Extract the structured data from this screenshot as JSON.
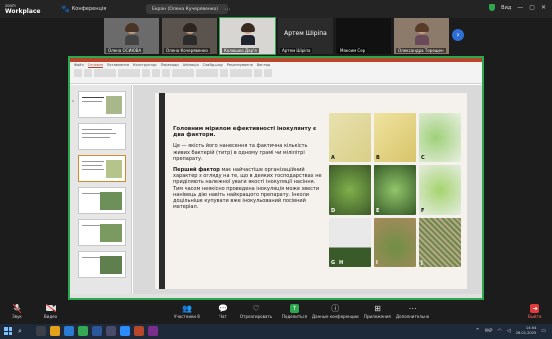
{
  "zoom": {
    "brand_small": "zoom",
    "brand_big": "Workplace"
  },
  "topbar": {
    "conference_label": "Конференція",
    "share_status": "Екран (Олена Кучерявенко)",
    "view_label": "Вид"
  },
  "participants": [
    {
      "name": "Олена ОСИЮВА"
    },
    {
      "name": "Олена Кочерявенко"
    },
    {
      "name": "Колюшко Дар'я"
    },
    {
      "name": "Артем Шіріпа"
    },
    {
      "name": "Максим Сер"
    },
    {
      "name": "Олександра Терещен"
    }
  ],
  "participant_big_name": "Артем Шіріпа",
  "ribbon_tabs": [
    "Файл",
    "Основне",
    "Вставлення",
    "Конструктор",
    "Переходи",
    "Анімація",
    "Слайд-шоу",
    "Рецензування",
    "Вигляд"
  ],
  "slide": {
    "heading": "Головним мірилом ефективності інокулянту є два фактори.",
    "para1": "Це — якість його нанесення та фактична кількість живих бактерій (титр) в одному грамі чи мілілітрі препарату.",
    "para2_bold": "Перший фактор",
    "para2_rest": " має найчастіше організаційний характер з огляду на те, що в деяких господарствах не приділяють належної уваги якості інокуляції насіння. Тим часом неякісно проведена інокуляція може звести нанівець дію навіть найкращого препарату. Інколи доцільніше купувати вже інокульований посівний матеріал.",
    "photo_labels": [
      "A",
      "B",
      "C",
      "D",
      "E",
      "F",
      "G",
      "H",
      "I",
      "J"
    ]
  },
  "toolbar": {
    "audio": "Звук",
    "video": "Видео",
    "participants": "Участники",
    "participants_count": "8",
    "chat": "Чат",
    "react": "Отреагировать",
    "share": "Поделиться",
    "info": "Данные конференции",
    "apps": "Приложения",
    "more": "Дополнительно",
    "exit": "Выйти"
  },
  "taskbar": {
    "lang": "УКР",
    "time": "14:04",
    "date": "26.01.2025"
  },
  "colors": {
    "accent_green": "#2ea84f",
    "pp_orange": "#b7472a",
    "blue_next": "#2d6fd6"
  }
}
